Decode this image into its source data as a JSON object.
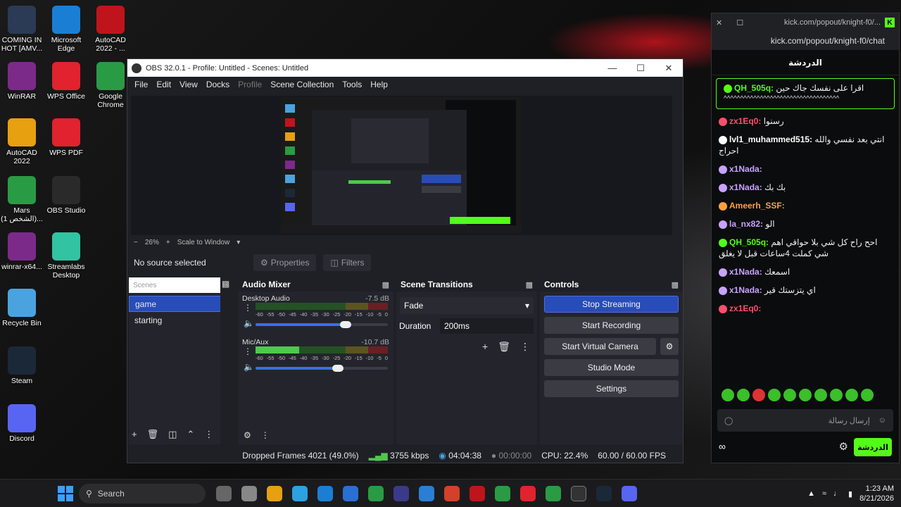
{
  "desktop": {
    "icons": [
      {
        "label": "COMING IN HOT [AMV...",
        "color": "#2b3a55"
      },
      {
        "label": "Microsoft Edge",
        "color": "#1a7fd4"
      },
      {
        "label": "AutoCAD 2022 - ...",
        "color": "#c0141c"
      },
      {
        "label": "WinRAR",
        "color": "#7c2a8a"
      },
      {
        "label": "WPS Office",
        "color": "#e0232e"
      },
      {
        "label": "Google Chrome",
        "color": "#2a9b45"
      },
      {
        "label": "AutoCAD 2022",
        "color": "#e6a010"
      },
      {
        "label": "WPS PDF",
        "color": "#e0232e"
      },
      {
        "label": "Mars (الشخص 1)...",
        "color": "#2a9b45"
      },
      {
        "label": "OBS Studio",
        "color": "#2a2a2a"
      },
      {
        "label": "winrar-x64...",
        "color": "#7c2a8a"
      },
      {
        "label": "Streamlabs Desktop",
        "color": "#31c3a2"
      },
      {
        "label": "Recycle Bin",
        "color": "#4aa3df"
      },
      {
        "label": "Steam",
        "color": "#1b2838"
      },
      {
        "label": "Discord",
        "color": "#5865f2"
      }
    ]
  },
  "obs": {
    "title": "OBS 32.0.1 - Profile: Untitled - Scenes: Untitled",
    "menu": [
      "File",
      "Edit",
      "View",
      "Docks",
      "Profile",
      "Scene Collection",
      "Tools",
      "Help"
    ],
    "zoom": "26%",
    "scale_mode": "Scale to Window",
    "no_source": "No source selected",
    "properties_label": "Properties",
    "filters_label": "Filters",
    "scenes": {
      "title": "Scenes",
      "items": [
        "game",
        "starting"
      ],
      "selected": "game"
    },
    "audio_mixer": {
      "title": "Audio Mixer",
      "channels": [
        {
          "name": "Desktop Audio",
          "db": "-7.5 dB",
          "level": 0.0,
          "volume": 0.68
        },
        {
          "name": "Mic/Aux",
          "db": "-10.7 dB",
          "level": 0.33,
          "volume": 0.62
        }
      ],
      "ticks": [
        "-60",
        "-55",
        "-50",
        "-45",
        "-40",
        "-35",
        "-30",
        "-25",
        "-20",
        "-15",
        "-10",
        "-5",
        "0"
      ]
    },
    "transitions": {
      "title": "Scene Transitions",
      "selected": "Fade",
      "duration_label": "Duration",
      "duration_value": "200",
      "duration_unit": "ms"
    },
    "controls": {
      "title": "Controls",
      "stop_streaming": "Stop Streaming",
      "start_recording": "Start Recording",
      "start_virtual_camera": "Start Virtual Camera",
      "studio_mode": "Studio Mode",
      "settings": "Settings"
    },
    "status": {
      "dropped_frames": "Dropped Frames 4021 (49.0%)",
      "bitrate": "3755 kbps",
      "stream_time": "04:04:38",
      "record_time": "00:00:00",
      "cpu": "CPU: 22.4%",
      "fps": "60.00 / 60.00 FPS"
    }
  },
  "kick": {
    "tab_url": "kick.com/popout/knight-f0/...",
    "url": "kick.com/popout/knight-f0/chat",
    "header": "الدردشة",
    "messages": [
      {
        "user": "QH_505q:",
        "text": "اقرا على نفسك جاك حين",
        "extra": "^^^^^^^^^^^^^^^^^^^^^^^^^^^^^^^^^^^",
        "color": "#53fc18"
      },
      {
        "user": "zx1Eq0:",
        "text": "رسنوا",
        "color": "#ff4d6d"
      },
      {
        "user": "lvl1_muhammed515:",
        "text": "انتي بعد نفسي والله احراج",
        "color": "#ffffff"
      },
      {
        "user": "x1Nada:",
        "text": "",
        "color": "#c8a2ff"
      },
      {
        "user": "x1Nada:",
        "text": "بك بك",
        "color": "#c8a2ff"
      },
      {
        "user": "Ameerh_SSF:",
        "text": "",
        "color": "#ff9f43"
      },
      {
        "user": "la_nx82:",
        "text": "الو",
        "color": "#c8a2ff"
      },
      {
        "user": "QH_505q:",
        "text": "احح راح كل شي بلا حواقي اهم شي كملت 4ساعات قبل لا يغلق",
        "color": "#53fc18"
      },
      {
        "user": "x1Nada:",
        "text": "اسمعك",
        "color": "#c8a2ff"
      },
      {
        "user": "x1Nada:",
        "text": "اي يتزستك قير",
        "color": "#c8a2ff"
      },
      {
        "user": "zx1Eq0:",
        "text": "",
        "color": "#ff4d6d"
      }
    ],
    "input_placeholder": "إرسال رسالة",
    "send_label": "الدردشة"
  },
  "taskbar": {
    "search_placeholder": "Search",
    "time": "1:23 AM",
    "date": "8/21/2026"
  }
}
